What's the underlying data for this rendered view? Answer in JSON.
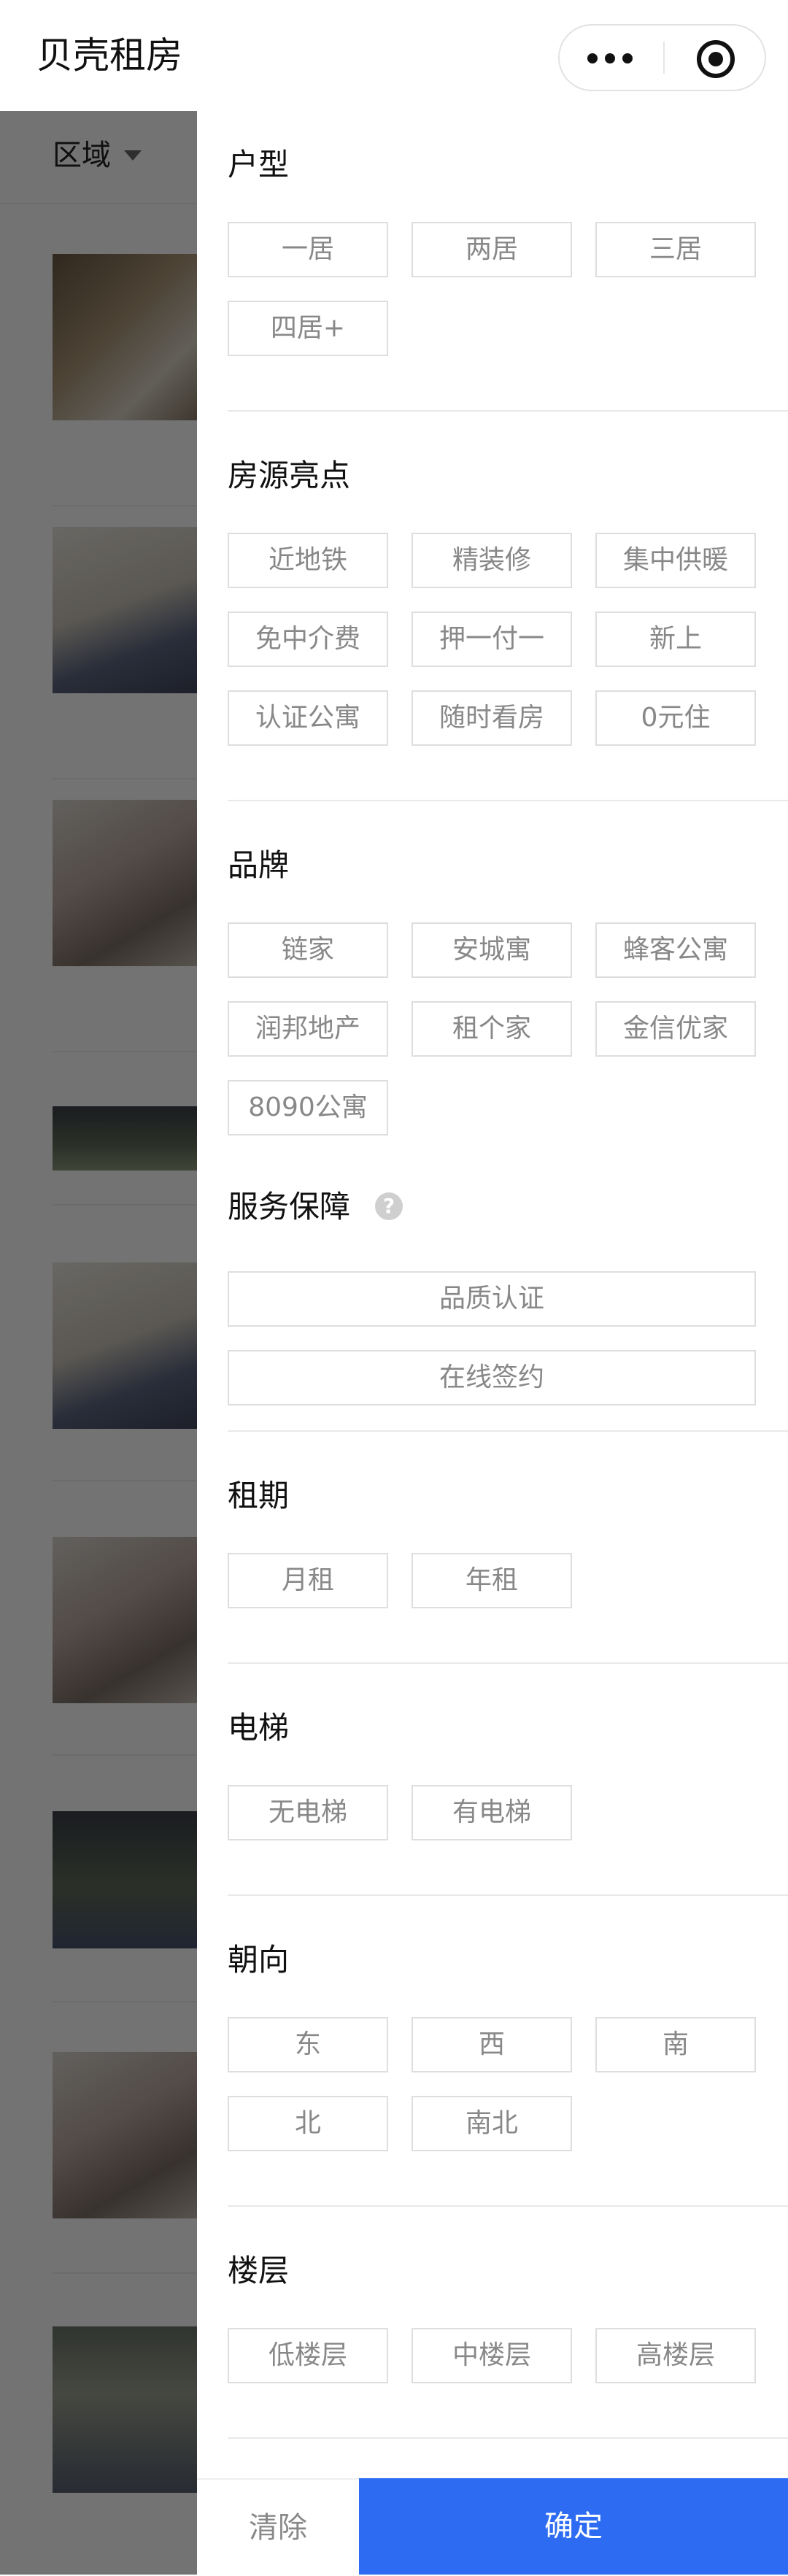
{
  "app": {
    "title": "贝壳租房"
  },
  "filter_bar": {
    "region_label": "区域"
  },
  "drawer": {
    "sections": {
      "layout": {
        "title": "户型",
        "options": [
          "一居",
          "两居",
          "三居",
          "四居+"
        ]
      },
      "highlights": {
        "title": "房源亮点",
        "options": [
          "近地铁",
          "精装修",
          "集中供暖",
          "免中介费",
          "押一付一",
          "新上",
          "认证公寓",
          "随时看房",
          "0元住"
        ]
      },
      "brand": {
        "title": "品牌",
        "options": [
          "链家",
          "安城寓",
          "蜂客公寓",
          "润邦地产",
          "租个家",
          "金信优家",
          "8090公寓"
        ]
      },
      "service": {
        "title": "服务保障",
        "help_icon_glyph": "?",
        "options": [
          "品质认证",
          "在线签约"
        ]
      },
      "lease": {
        "title": "租期",
        "options": [
          "月租",
          "年租"
        ]
      },
      "elevator": {
        "title": "电梯",
        "options": [
          "无电梯",
          "有电梯"
        ]
      },
      "orientation": {
        "title": "朝向",
        "options": [
          "东",
          "西",
          "南",
          "北",
          "南北"
        ]
      },
      "floor": {
        "title": "楼层",
        "options": [
          "低楼层",
          "中楼层",
          "高楼层"
        ]
      }
    },
    "footer": {
      "clear_label": "清除",
      "confirm_label": "确定"
    }
  },
  "colors": {
    "accent": "#2d6cf2",
    "chip_border": "#dedede",
    "chip_text": "#888888",
    "overlay": "rgba(0,0,0,0.55)"
  },
  "icons": {
    "more": "more-dots-icon",
    "close": "target-circle-icon",
    "help": "question-circle-icon",
    "caret": "caret-down-icon"
  }
}
